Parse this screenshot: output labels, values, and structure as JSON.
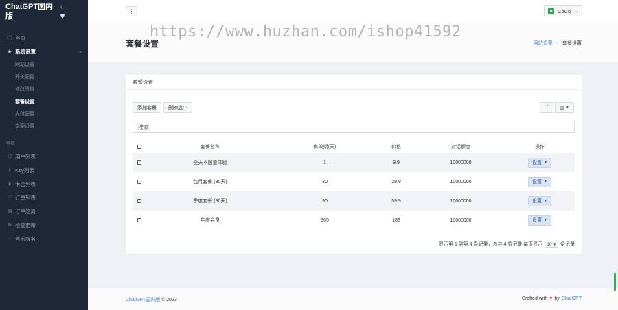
{
  "sidebar": {
    "brand": "ChatGPT国内版",
    "moon_glyph": "☾",
    "shield_glyph": "⛊",
    "home": "首页",
    "system_settings": "系统设置",
    "sub_items": [
      "网站设置",
      "开关配置",
      "修改资料",
      "套餐设置",
      "支付配置",
      "文案设置"
    ],
    "section_label": "导航",
    "nav_items": [
      "用户列表",
      "Key列表",
      "卡密列表",
      "订单列表",
      "订单趋势",
      "检查更新",
      "售后服务"
    ]
  },
  "topbar": {
    "menu_glyph": "⋮",
    "username": "CoCo"
  },
  "page": {
    "title": "套餐设置",
    "breadcrumb_link": "网站设置",
    "breadcrumb_current": "套餐设置"
  },
  "watermark": "https://www.huzhan.com/ishop41592",
  "card": {
    "title": "套餐设置",
    "add_button": "添加套餐",
    "delete_button": "删除选中",
    "fullscreen_glyph": "⛶",
    "columns_glyph": "▥",
    "search_placeholder": "搜索",
    "columns": [
      "套餐名称",
      "有效期(天)",
      "价格",
      "对话额度",
      "操作"
    ],
    "rows": [
      {
        "name": "全天不限量体验",
        "days": "1",
        "price": "9.9",
        "quota": "10000000",
        "action": "设置"
      },
      {
        "name": "包月套餐 (30天)",
        "days": "30",
        "price": "29.9",
        "quota": "10000000",
        "action": "设置"
      },
      {
        "name": "季度套餐 (90天)",
        "days": "90",
        "price": "59.9",
        "quota": "10000000",
        "action": "设置"
      },
      {
        "name": "年度会员",
        "days": "365",
        "price": "188",
        "quota": "10000000",
        "action": "设置"
      }
    ],
    "pager_text": "显示第 1 到第 4 条记录，总共 4 条记录 每页显示",
    "pager_size": "10",
    "pager_suffix": "条记录"
  },
  "footer": {
    "brand": "ChatGPT国内版",
    "copyright": "© 2023",
    "crafted": "Crafted with",
    "by": "by",
    "author": "ChatGPT"
  },
  "colors": {
    "sidebar_bg": "#1e2838",
    "accent": "#4a7fd1",
    "heart": "#d9263c"
  }
}
